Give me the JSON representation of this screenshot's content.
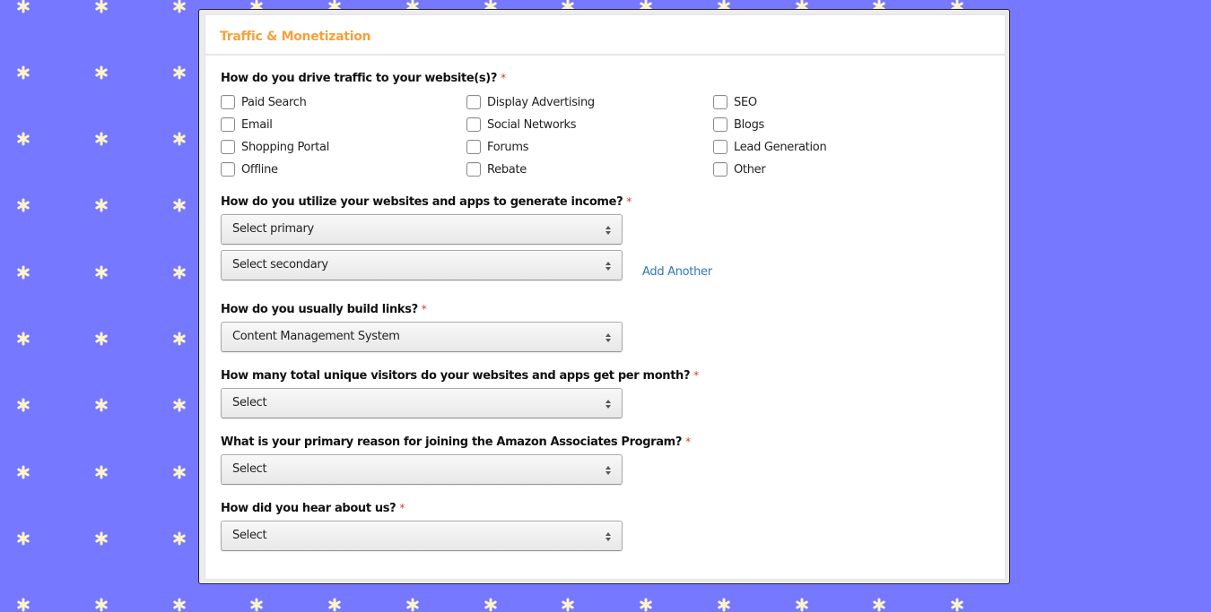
{
  "background": {
    "color": "#7679ff",
    "pattern_icon": "asterisk-icon",
    "pattern_color": "#fdf4c8"
  },
  "section": {
    "title": "Traffic & Monetization",
    "title_color": "#f7a13a"
  },
  "required_marker": "*",
  "traffic": {
    "question": "How do you drive traffic to your website(s)?",
    "options": [
      {
        "label": "Paid Search",
        "checked": false
      },
      {
        "label": "Display Advertising",
        "checked": false
      },
      {
        "label": "SEO",
        "checked": false
      },
      {
        "label": "Email",
        "checked": false
      },
      {
        "label": "Social Networks",
        "checked": false
      },
      {
        "label": "Blogs",
        "checked": false
      },
      {
        "label": "Shopping Portal",
        "checked": false
      },
      {
        "label": "Forums",
        "checked": false
      },
      {
        "label": "Lead Generation",
        "checked": false
      },
      {
        "label": "Offline",
        "checked": false
      },
      {
        "label": "Rebate",
        "checked": false
      },
      {
        "label": "Other",
        "checked": false
      }
    ]
  },
  "income": {
    "question": "How do you utilize your websites and apps to generate income?",
    "primary_value": "Select primary",
    "secondary_value": "Select secondary",
    "add_another_label": "Add Another",
    "link_color": "#2f78b8"
  },
  "links": {
    "question": "How do you usually build links?",
    "value": "Content Management System"
  },
  "visitors": {
    "question": "How many total unique visitors do your websites and apps get per month?",
    "value": "Select"
  },
  "reason": {
    "question": "What is your primary reason for joining the Amazon Associates Program?",
    "value": "Select"
  },
  "heard": {
    "question": "How did you hear about us?",
    "value": "Select"
  },
  "icons": {
    "select_arrows": "updown-arrows-icon",
    "checkbox": "checkbox-icon"
  }
}
